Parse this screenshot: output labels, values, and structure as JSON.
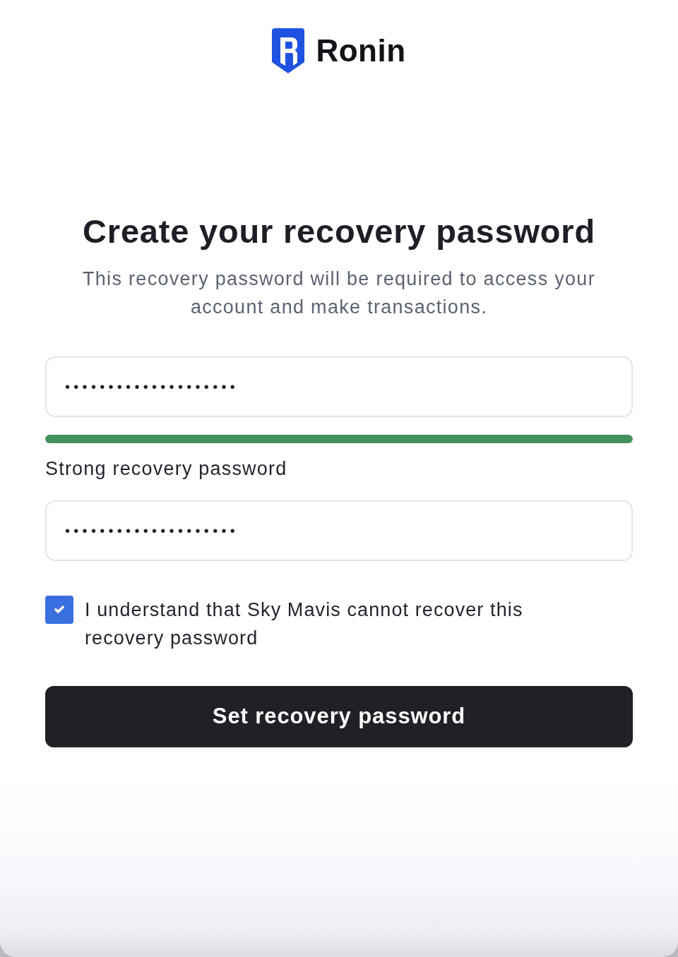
{
  "header": {
    "brand": "Ronin"
  },
  "title": "Create your recovery password",
  "description": "This recovery password will be required to access your account and make transactions.",
  "password_field": {
    "value": "••••••••••••••••••••"
  },
  "strength_meter": {
    "level": 1,
    "label": "Strong recovery password"
  },
  "confirm_field": {
    "value": "••••••••••••••••••••"
  },
  "agreement": {
    "checked": true,
    "label": "I understand that Sky Mavis cannot recover this recovery password"
  },
  "submit_button": {
    "label": "Set recovery password"
  }
}
